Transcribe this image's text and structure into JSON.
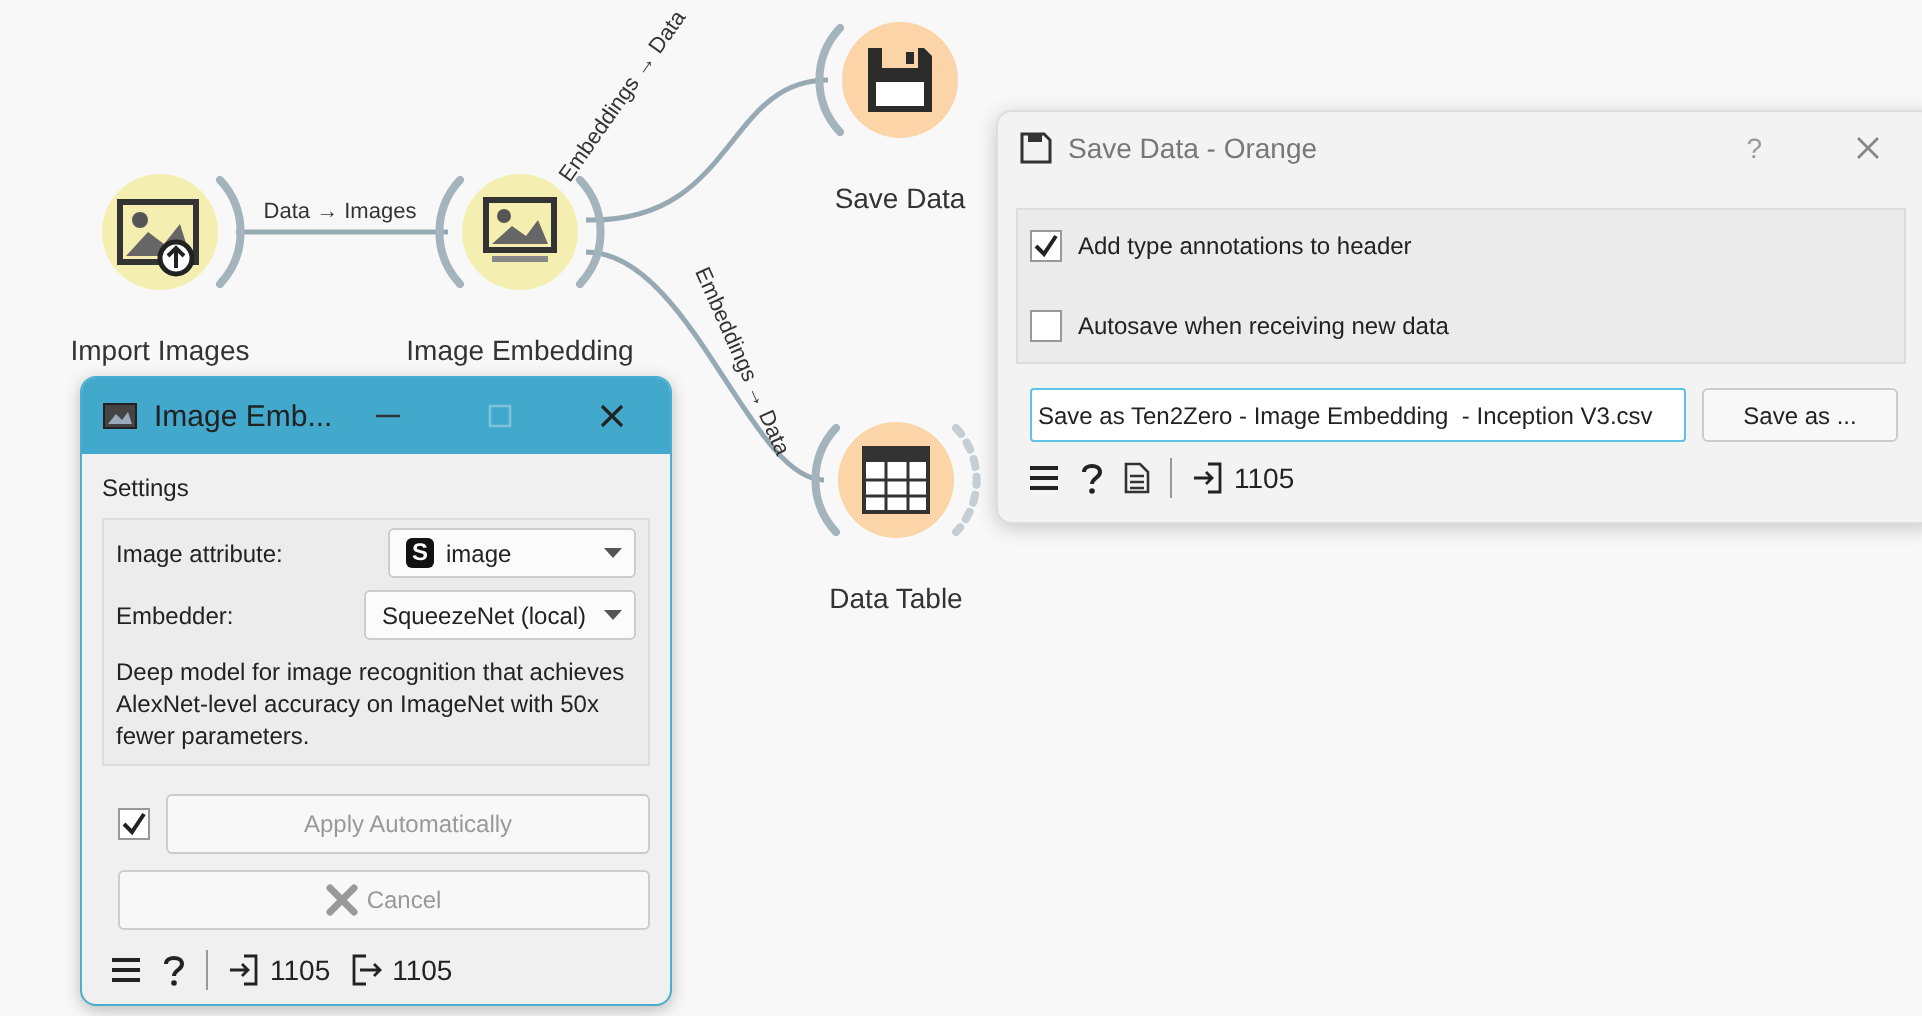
{
  "canvas": {
    "nodes": [
      {
        "label": "Import Images",
        "kind": "import-images",
        "color": "#f4efb0"
      },
      {
        "label": "Image Embedding",
        "kind": "image-embedding",
        "color": "#f4efb0"
      },
      {
        "label": "Save Data",
        "kind": "save",
        "color": "#fbd5a8"
      },
      {
        "label": "Data Table",
        "kind": "table",
        "color": "#fbd5a8"
      }
    ],
    "links": [
      {
        "label": "Data → Images"
      },
      {
        "label": "Embeddings → Data"
      },
      {
        "label": "Embeddings → Data"
      }
    ]
  },
  "embedding_window": {
    "title": "Image Emb...",
    "section": "Settings",
    "fields": [
      {
        "label": "Image attribute:",
        "value": "image",
        "type_badge": "S"
      },
      {
        "label": "Embedder:",
        "value": "SqueezeNet (local)"
      }
    ],
    "description": "Deep model for image recognition that achieves AlexNet-level accuracy on ImageNet with 50x fewer parameters.",
    "auto_apply": {
      "checked": true,
      "label": "Apply Automatically",
      "disabled": true
    },
    "cancel": {
      "label": "Cancel",
      "disabled": true
    },
    "status": {
      "input_count": "1105",
      "output_count": "1105"
    }
  },
  "save_window": {
    "title": "Save Data - Orange",
    "help": "?",
    "options": [
      {
        "label": "Add type annotations to header",
        "checked": true
      },
      {
        "label": "Autosave when receiving new data",
        "checked": false
      }
    ],
    "filename": "Save as Ten2Zero - Image Embedding  - Inception V3.csv",
    "save_button": "Save as ...",
    "status": {
      "input_count": "1105"
    }
  }
}
